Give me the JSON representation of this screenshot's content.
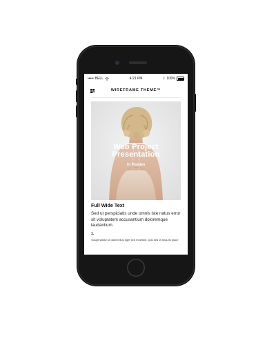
{
  "statusbar": {
    "carrier": "BELL",
    "time": "4:21 PM",
    "battery": "100%"
  },
  "header": {
    "title": "WIREFRAME THEME™",
    "logo_icon": "grid-logo-icon"
  },
  "hero": {
    "title_line1": "Web Project",
    "title_line2": "Presentation",
    "byline_prefix": "By",
    "byline_author": "Pixeden"
  },
  "content": {
    "section_title": "Full Wide Text",
    "body": "Sed ut perspiciatis unde omnis iste natus error sit voluptatem accusantium doloremque laudantium.",
    "list_number": "1.",
    "list_text": "Suspendisse ut diam tellus eget sed molestie, quis sed ta tmauris place"
  },
  "colors": {
    "phone": "#161616",
    "screen": "#ffffff",
    "hero_bg": "#ececec"
  }
}
